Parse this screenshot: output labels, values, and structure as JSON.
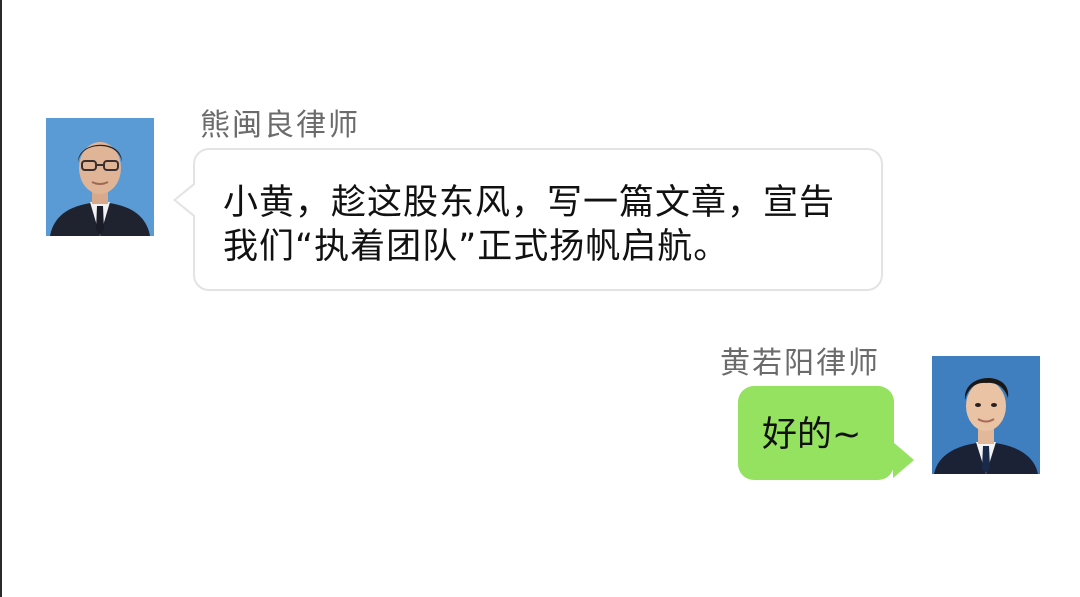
{
  "messages": [
    {
      "side": "left",
      "sender": "熊闽良律师",
      "avatar": "man-glasses-suit-avatar",
      "text": "小黄，趁这股东风，写一篇文章，宣告我们“执着团队”正式扬帆启航。"
    },
    {
      "side": "right",
      "sender": "黄若阳律师",
      "avatar": "young-man-suit-avatar",
      "text": "好的~",
      "bubble_color": "#95e160"
    }
  ],
  "colors": {
    "incoming_bubble": "#ffffff",
    "incoming_border": "#e3e3e3",
    "outgoing_bubble": "#95e160",
    "name_text": "#6b6b6b",
    "avatar_background": "#5f9ed6"
  }
}
